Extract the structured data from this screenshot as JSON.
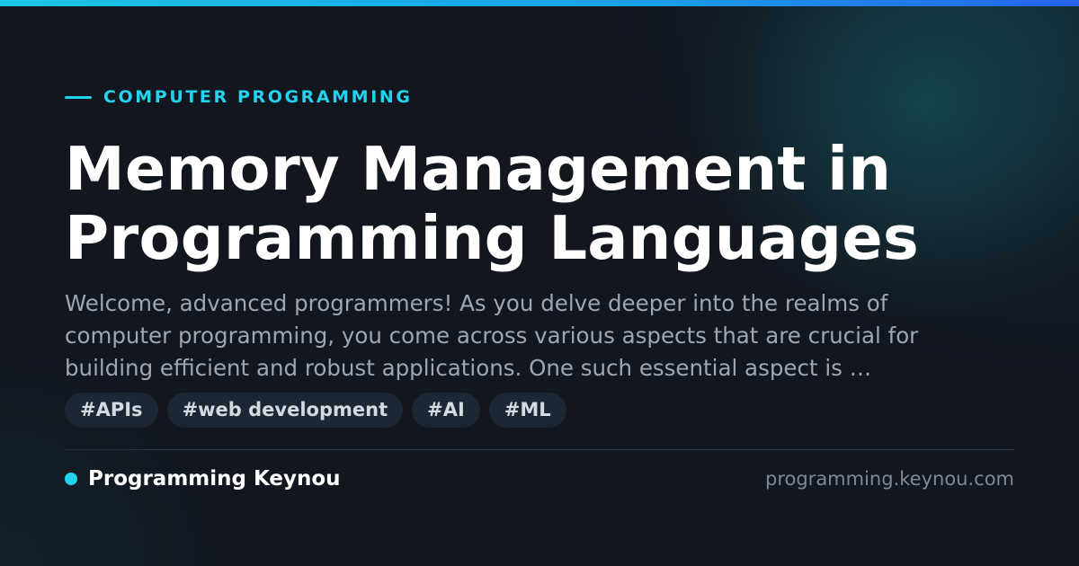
{
  "category": "COMPUTER PROGRAMMING",
  "title_lines": [
    "Memory Management in",
    "Programming Languages"
  ],
  "excerpt_lines": [
    "Welcome, advanced programmers! As you delve deeper into the realms of",
    "computer programming, you come across various aspects that are crucial for",
    "building efficient and robust applications. One such essential aspect is …"
  ],
  "tags": [
    "#APIs",
    "#web development",
    "#AI",
    "#ML"
  ],
  "brand": {
    "name": "Programming Keynou",
    "url": "programming.keynou.com"
  },
  "colors": {
    "accent": "#22d3ee",
    "background": "#12161f",
    "tag_background": "#1d2633"
  }
}
